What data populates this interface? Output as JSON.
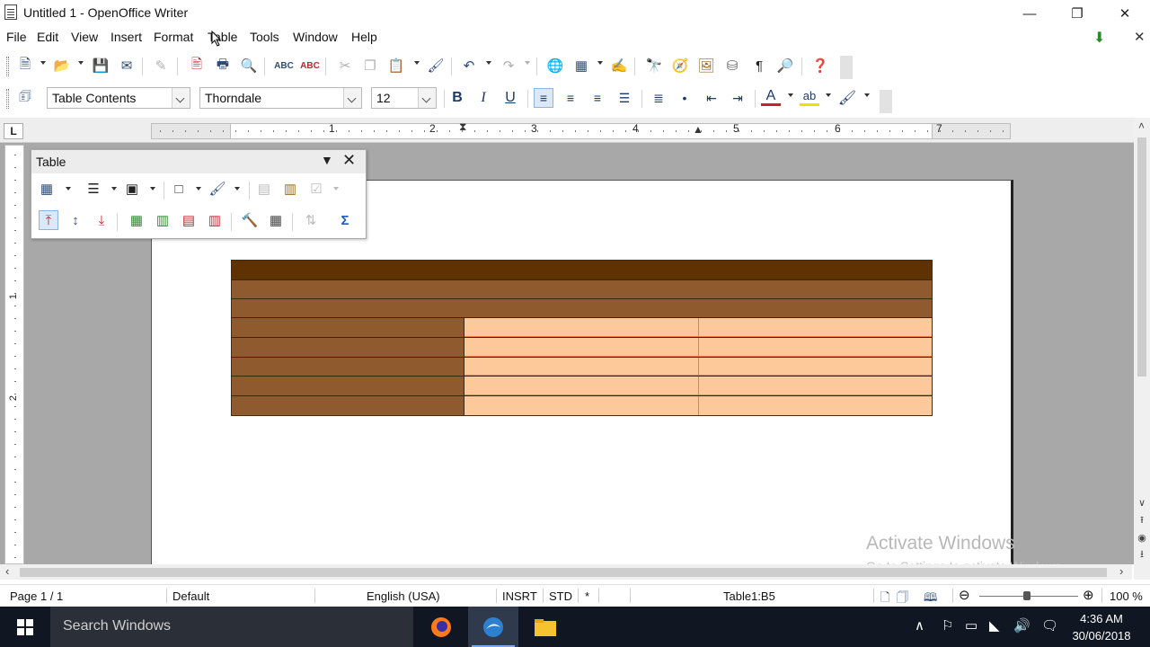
{
  "window": {
    "title": "Untitled 1 - OpenOffice Writer",
    "minimize": "—",
    "maximize": "❐",
    "close": "✕"
  },
  "menu": {
    "file": "File",
    "edit": "Edit",
    "view": "View",
    "insert": "Insert",
    "format": "Format",
    "table": "Table",
    "tools": "Tools",
    "window": "Window",
    "help": "Help"
  },
  "formatting": {
    "paragraph_style": "Table Contents",
    "font_name": "Thorndale",
    "font_size": "12",
    "bold": "B",
    "italic": "I",
    "underline": "U"
  },
  "ruler": {
    "corner": "L",
    "numbers": [
      "1",
      "2",
      "3",
      "4",
      "5",
      "6",
      "7"
    ],
    "vertical_numbers": [
      "1",
      "2"
    ]
  },
  "table_toolbar": {
    "title": "Table"
  },
  "document_table": {
    "colors": {
      "header_row": "#5e3203",
      "brown_band": "#8f5a2e",
      "label_column": "#8f5a2e",
      "data_cell": "#fdc99a",
      "data_border": "#f07a4a",
      "dark_border": "#3e2508"
    }
  },
  "watermark": {
    "line1": "Activate Windows",
    "line2": "Go to Settings to activate Windows."
  },
  "status": {
    "page": "Page 1 / 1",
    "page_style": "Default",
    "language": "English (USA)",
    "insert_mode": "INSRT",
    "selection_mode": "STD",
    "modified": "*",
    "cell_ref": "Table1:B5",
    "zoom": "100 %"
  },
  "taskbar": {
    "search_placeholder": "Search Windows",
    "time": "4:36 AM",
    "date": "30/06/2018"
  }
}
